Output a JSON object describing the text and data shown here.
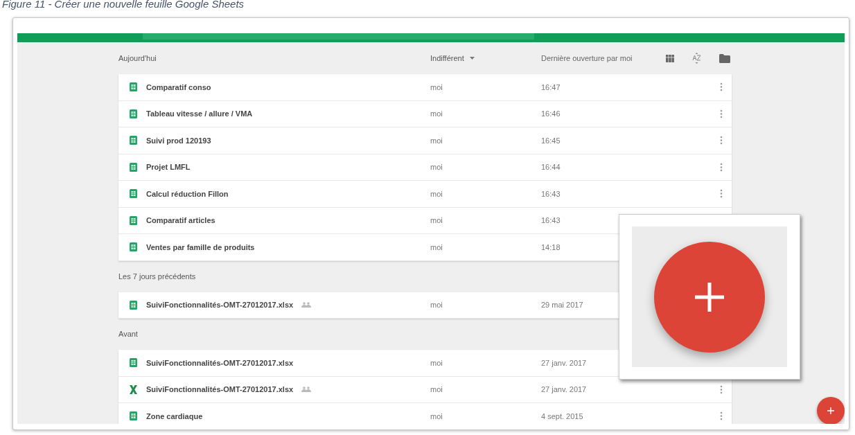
{
  "caption": "Figure 11 - Créer une nouvelle feuille Google Sheets",
  "columns": {
    "owner_filter": "Indifférent",
    "sort": "Dernière ouverture par moi"
  },
  "sections": [
    {
      "title": "Aujourd'hui",
      "rows": [
        {
          "name": "Comparatif conso",
          "kind": "sheets",
          "shared": false,
          "owner": "moi",
          "date": "16:47",
          "menu": true
        },
        {
          "name": "Tableau vitesse / allure / VMA",
          "kind": "sheets",
          "shared": false,
          "owner": "moi",
          "date": "16:46",
          "menu": true
        },
        {
          "name": "Suivi prod 120193",
          "kind": "sheets",
          "shared": false,
          "owner": "moi",
          "date": "16:45",
          "menu": true
        },
        {
          "name": "Projet LMFL",
          "kind": "sheets",
          "shared": false,
          "owner": "moi",
          "date": "16:44",
          "menu": true
        },
        {
          "name": "Calcul réduction Fillon",
          "kind": "sheets",
          "shared": false,
          "owner": "moi",
          "date": "16:43",
          "menu": true
        },
        {
          "name": "Comparatif articles",
          "kind": "sheets",
          "shared": false,
          "owner": "moi",
          "date": "16:43",
          "menu": false
        },
        {
          "name": "Ventes par famille de produits",
          "kind": "sheets",
          "shared": false,
          "owner": "moi",
          "date": "14:18",
          "menu": false
        }
      ]
    },
    {
      "title": "Les 7 jours précédents",
      "rows": [
        {
          "name": "SuiviFonctionnalités-OMT-27012017.xlsx",
          "kind": "sheets",
          "shared": true,
          "owner": "moi",
          "date": "29 mai 2017",
          "menu": false
        }
      ]
    },
    {
      "title": "Avant",
      "rows": [
        {
          "name": "SuiviFonctionnalités-OMT-27012017.xlsx",
          "kind": "sheets",
          "shared": false,
          "owner": "moi",
          "date": "27 janv. 2017",
          "menu": false
        },
        {
          "name": "SuiviFonctionnalités-OMT-27012017.xlsx",
          "kind": "excel",
          "shared": true,
          "owner": "moi",
          "date": "27 janv. 2017",
          "menu": true
        },
        {
          "name": "Zone cardiaque",
          "kind": "sheets",
          "shared": false,
          "owner": "moi",
          "date": "4 sept. 2015",
          "menu": true
        }
      ]
    }
  ]
}
